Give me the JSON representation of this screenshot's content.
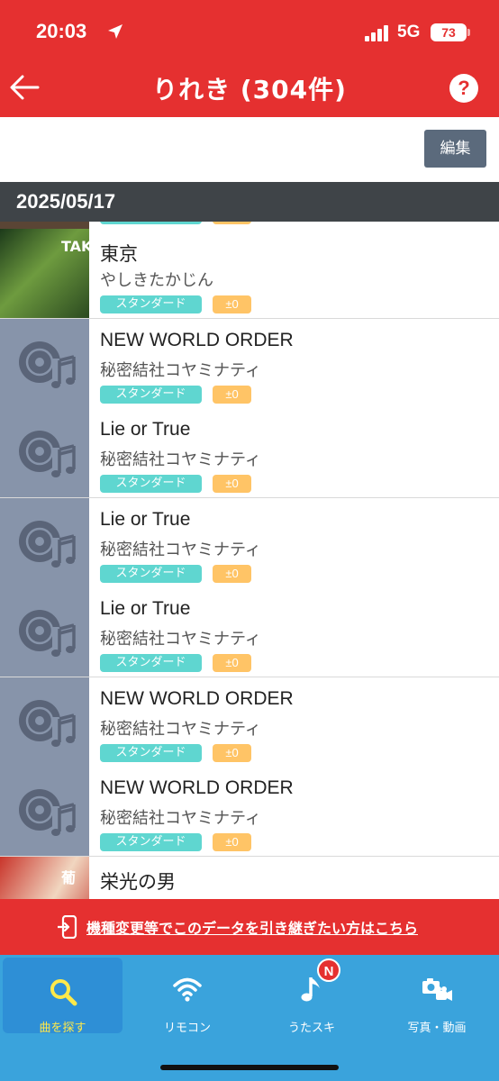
{
  "status_bar": {
    "time": "20:03",
    "network": "5G",
    "battery": "73"
  },
  "header": {
    "title": "りれき (304件)",
    "help_label": "?"
  },
  "toolbar": {
    "edit_label": "編集"
  },
  "date_header": "2025/05/17",
  "history": [
    {
      "title": "東京",
      "artist": "やしきたかじん",
      "tag": "スタンダード",
      "key": "±0",
      "thumb": "album-art",
      "thumb_text": "TAKAJIN"
    },
    {
      "title": "NEW WORLD ORDER",
      "artist": "秘密結社コヤミナティ",
      "tag": "スタンダード",
      "key": "±0",
      "thumb": "music-disc-icon"
    },
    {
      "title": "Lie or True",
      "artist": "秘密結社コヤミナティ",
      "tag": "スタンダード",
      "key": "±0",
      "thumb": "music-disc-icon"
    },
    {
      "title": "Lie or True",
      "artist": "秘密結社コヤミナティ",
      "tag": "スタンダード",
      "key": "±0",
      "thumb": "music-disc-icon"
    },
    {
      "title": "Lie or True",
      "artist": "秘密結社コヤミナティ",
      "tag": "スタンダード",
      "key": "±0",
      "thumb": "music-disc-icon"
    },
    {
      "title": "NEW WORLD ORDER",
      "artist": "秘密結社コヤミナティ",
      "tag": "スタンダード",
      "key": "±0",
      "thumb": "music-disc-icon"
    },
    {
      "title": "NEW WORLD ORDER",
      "artist": "秘密結社コヤミナティ",
      "tag": "スタンダード",
      "key": "±0",
      "thumb": "music-disc-icon"
    },
    {
      "title": "栄光の男",
      "artist": "",
      "tag": "",
      "key": "",
      "thumb": "album-art",
      "thumb_text": "葡"
    }
  ],
  "transfer_banner": "機種変更等でこのデータを引き継ぎたい方はこちら",
  "tabs": [
    {
      "label": "曲を探す",
      "icon": "search-icon"
    },
    {
      "label": "リモコン",
      "icon": "wifi-icon"
    },
    {
      "label": "うたスキ",
      "icon": "music-note-icon",
      "badge": "N"
    },
    {
      "label": "写真・動画",
      "icon": "camera-icon"
    }
  ],
  "colors": {
    "brand_red": "#e53030",
    "tab_blue": "#3aa3dc",
    "tag_teal": "#5fd6d0",
    "tag_orange": "#ffc466",
    "active_label": "#ffe94a"
  }
}
